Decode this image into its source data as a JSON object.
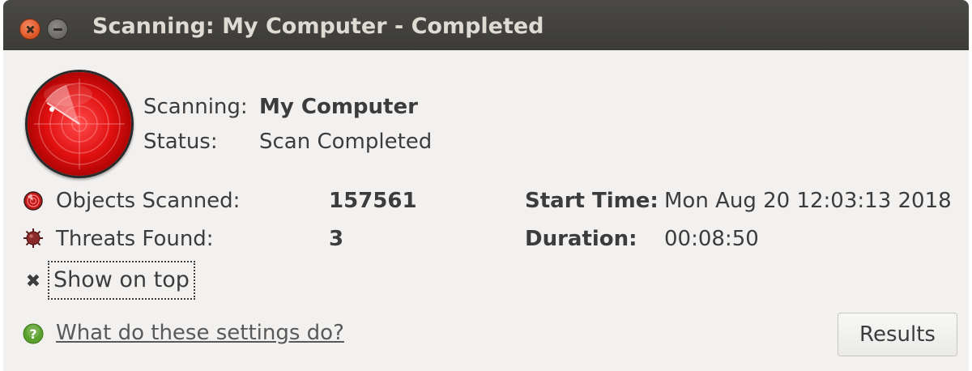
{
  "window": {
    "title": "Scanning: My Computer - Completed"
  },
  "scan": {
    "scanning_label": "Scanning:",
    "scanning_value": "My Computer",
    "status_label": "Status:",
    "status_value": "Scan Completed"
  },
  "stats": {
    "objects_label": "Objects Scanned:",
    "objects_value": "157561",
    "threats_label": "Threats Found:",
    "threats_value": "3",
    "start_label": "Start Time:",
    "start_value": "Mon Aug 20 12:03:13 2018",
    "duration_label": "Duration:",
    "duration_value": "00:08:50"
  },
  "options": {
    "show_on_top_label": "Show on top",
    "show_on_top_checked": true,
    "check_glyph": "✖"
  },
  "footer": {
    "help_link": "What do these settings do?",
    "results_button": "Results"
  },
  "icons": {
    "close": "close-icon",
    "minimize": "minimize-icon",
    "radar": "radar-icon",
    "objects": "objects-scanned-icon",
    "threats": "virus-icon",
    "help": "help-icon"
  },
  "colors": {
    "titlebar": "#3c3b37",
    "close_button": "#e05a2a",
    "radar_red": "#e01010",
    "help_green": "#5aa02c"
  }
}
